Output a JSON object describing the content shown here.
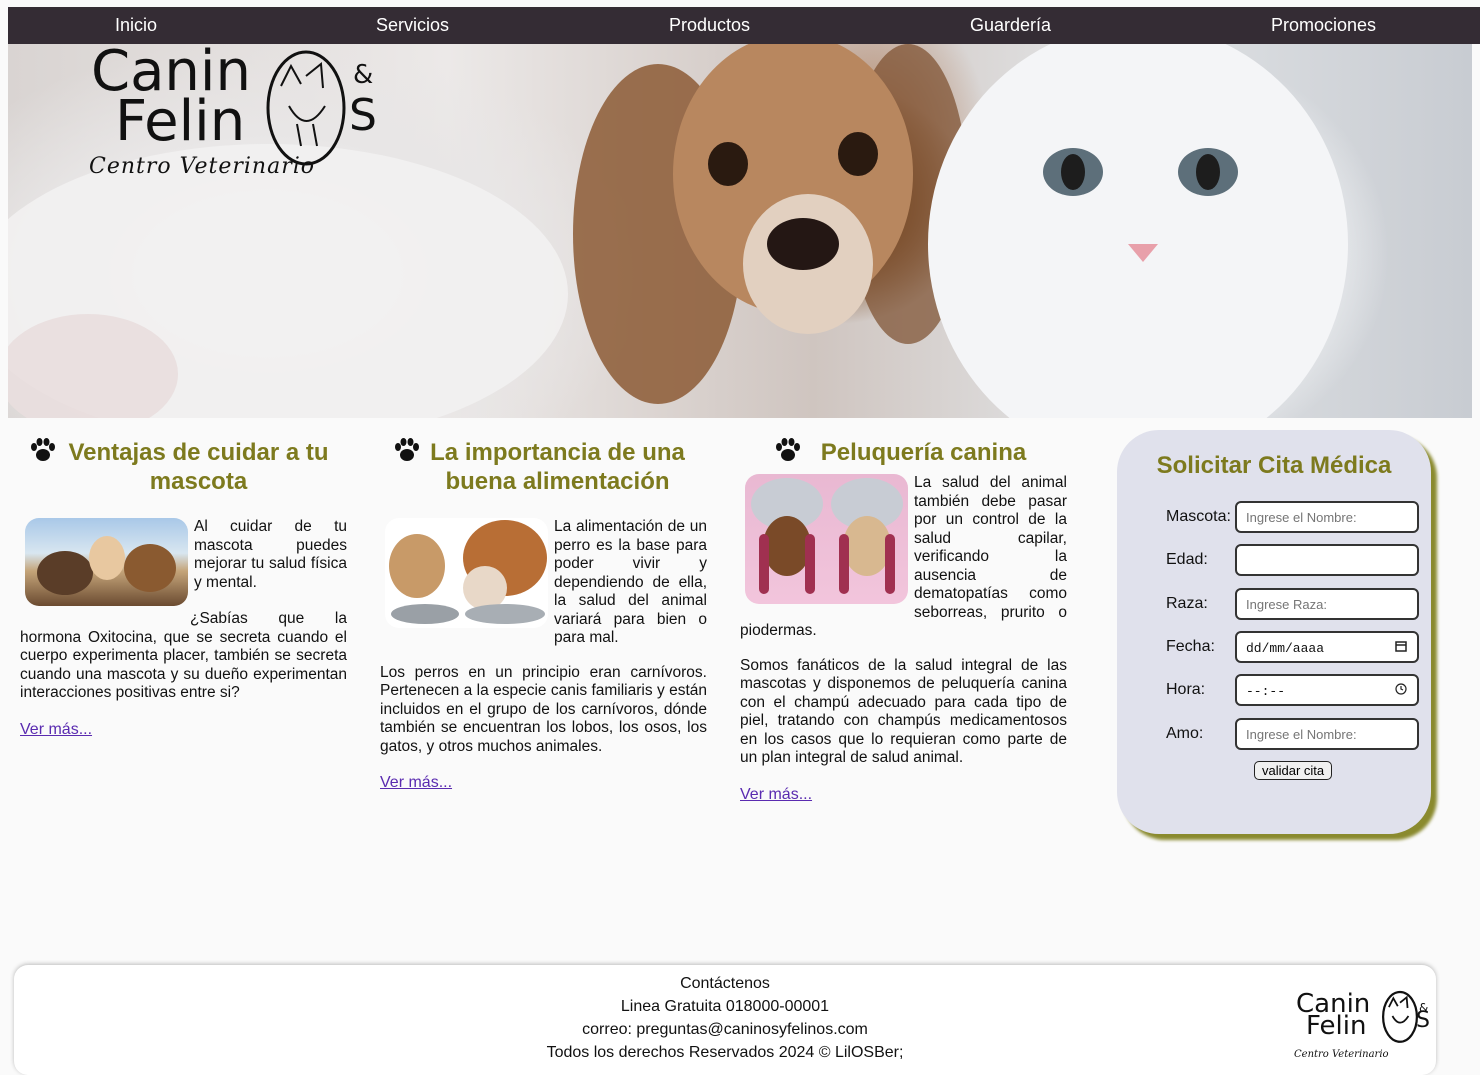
{
  "nav": {
    "items": [
      "Inicio",
      "Servicios",
      "Productos",
      "Guardería",
      "Promociones"
    ]
  },
  "logo": {
    "line1": "Canin",
    "line2": "Felin",
    "amp": "&",
    "s": "S",
    "tagline": "Centro Veterinario"
  },
  "articles": [
    {
      "title": "Ventajas de cuidar a tu mascota",
      "text1": "Al cuidar de tu mascota puedes mejorar tu salud física y mental.",
      "text2": "¿Sabías que la hormona Oxitocina, que se secreta cuando el cuerpo experimenta placer, también se secreta cuando una mascota y su dueño experimentan interacciones positivas entre si?",
      "link": "Ver más..."
    },
    {
      "title": "La importancia de una buena alimentación",
      "text1": "La alimentación de un perro es la base para poder vivir y dependiendo de ella, la salud del animal variará para bien o para mal.",
      "text2": "Los perros en un principio eran carnívoros. Pertenecen a la especie canis familiaris y están incluidos en el grupo de los carnívoros, dónde también se encuentran los lobos, los osos, los gatos, y otros muchos animales.",
      "link": "Ver más..."
    },
    {
      "title": "Peluquería canina",
      "text1": "La salud del animal también debe pasar por un control de la salud capilar, verificando la ausencia de dematopatías como seborreas, prurito o piodermas.",
      "text2": "Somos fanáticos de la salud integral de las mascotas y disponemos de peluquería canina con el champú adecuado para cada tipo de piel, tratando con champús medicamentosos en los casos que lo requieran como parte de un plan integral de salud animal.",
      "link": "Ver más..."
    }
  ],
  "form": {
    "title": "Solicitar Cita Médica",
    "mascota_label": "Mascota:",
    "mascota_placeholder": "Ingrese el Nombre:",
    "edad_label": "Edad:",
    "raza_label": "Raza:",
    "raza_placeholder": "Ingrese Raza:",
    "fecha_label": "Fecha:",
    "fecha_value": "dd/mm/aaaa",
    "hora_label": "Hora:",
    "hora_value": "--:--",
    "amo_label": "Amo:",
    "amo_placeholder": "Ingrese el Nombre:",
    "submit": "validar cita"
  },
  "footer": {
    "lines": [
      "Contáctenos",
      "Linea Gratuita 018000-00001",
      "correo: preguntas@caninosyfelinos.com",
      "Todos los derechos Reservados 2024 © LilOSBer;"
    ]
  },
  "colors": {
    "nav_bg": "#342c34",
    "heading": "#7d7a1e",
    "form_bg": "#e0e1ec",
    "form_shadow": "#8a8a2e",
    "link": "#5a2bb0"
  }
}
